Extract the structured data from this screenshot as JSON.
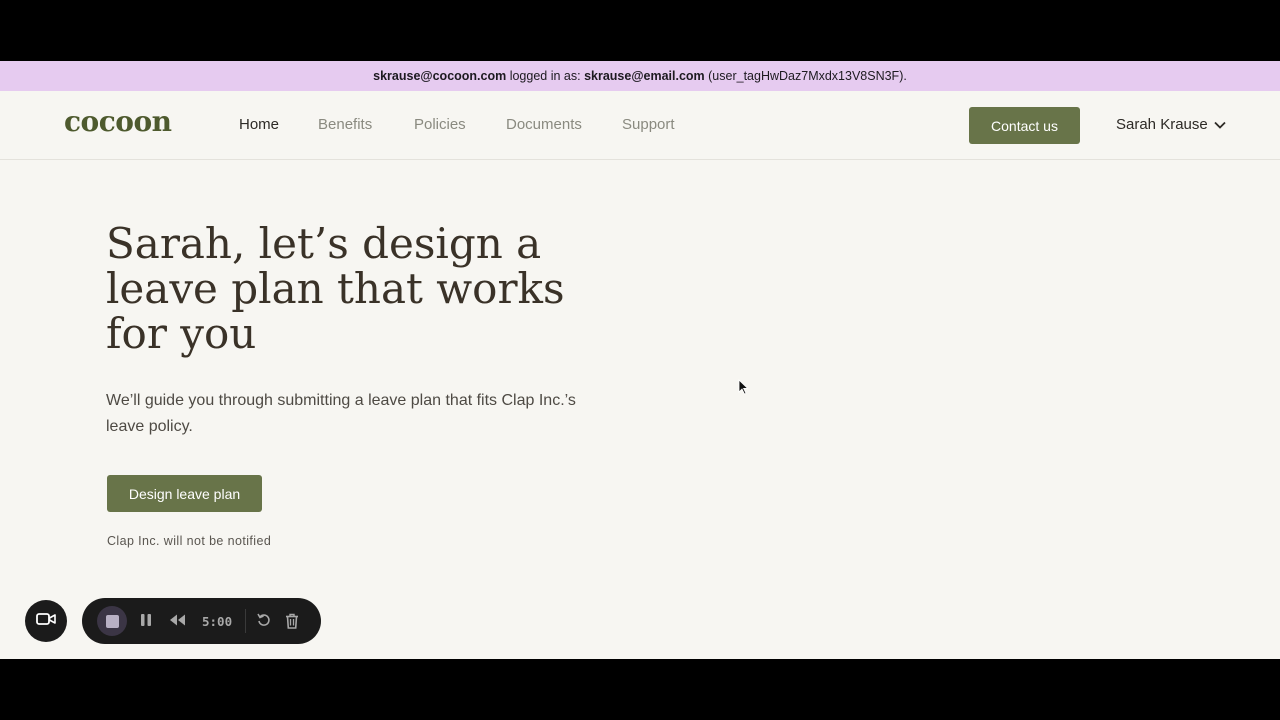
{
  "impersonation": {
    "admin_email": "skrause@cocoon.com",
    "middle_text": " logged in as: ",
    "user_email": "skrause@email.com",
    "user_id": " (user_tagHwDaz7Mxdx13V8SN3F)."
  },
  "nav": {
    "logo": "cocoon",
    "links": [
      "Home",
      "Benefits",
      "Policies",
      "Documents",
      "Support"
    ],
    "active": "Home",
    "contact_label": "Contact us",
    "user_name": "Sarah Krause"
  },
  "hero": {
    "title": "Sarah, let’s design a leave plan that works for you",
    "description": "We’ll guide you through submitting a leave plan that fits Clap Inc.’s leave policy.",
    "cta_label": "Design leave plan",
    "note": "Clap Inc. will not be notified"
  },
  "recorder": {
    "timer": "5:00",
    "icons": [
      "camera-icon",
      "stop-icon",
      "pause-icon",
      "rewind-icon",
      "restart-icon",
      "trash-icon"
    ]
  },
  "colors": {
    "brand_green": "#687449",
    "logo_green": "#4e5a2e",
    "banner_lavender": "#e6cbf0",
    "page_bg": "#f7f6f2"
  }
}
